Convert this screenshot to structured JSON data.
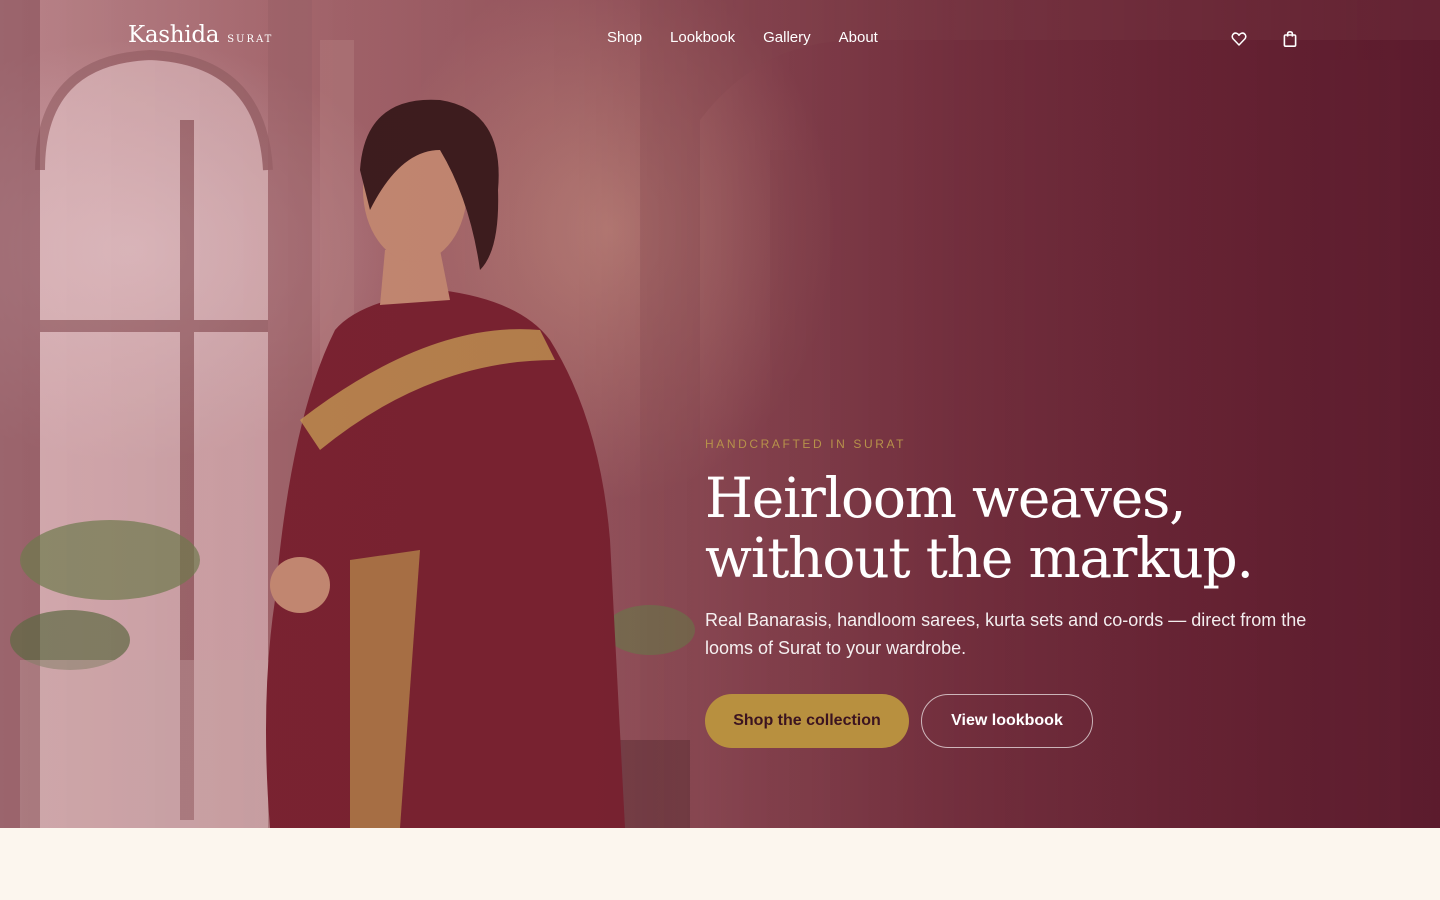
{
  "brand": {
    "name": "Kashida",
    "tagline": "SURAT"
  },
  "nav": {
    "items": [
      {
        "label": "Shop"
      },
      {
        "label": "Lookbook"
      },
      {
        "label": "Gallery"
      },
      {
        "label": "About"
      }
    ]
  },
  "icons": {
    "wishlist": "heart-icon",
    "cart": "shopping-bag-icon"
  },
  "hero": {
    "eyebrow": "HANDCRAFTED IN SURAT",
    "headline_line1": "Heirloom weaves,",
    "headline_line2": "without the markup.",
    "subcopy": "Real Banarasis, handloom sarees, kurta sets and co-ords — direct from the looms of Surat to your wardrobe.",
    "primary_cta": "Shop the collection",
    "secondary_cta": "View lookbook",
    "image": "woman-in-maroon-saree-photo"
  },
  "colors": {
    "hero_overlay": "#6c2a38",
    "accent_gold": "#b8903f",
    "button_text_dark": "#3c1420",
    "page_background": "#fcf6ee",
    "text_light": "#ffffff"
  }
}
